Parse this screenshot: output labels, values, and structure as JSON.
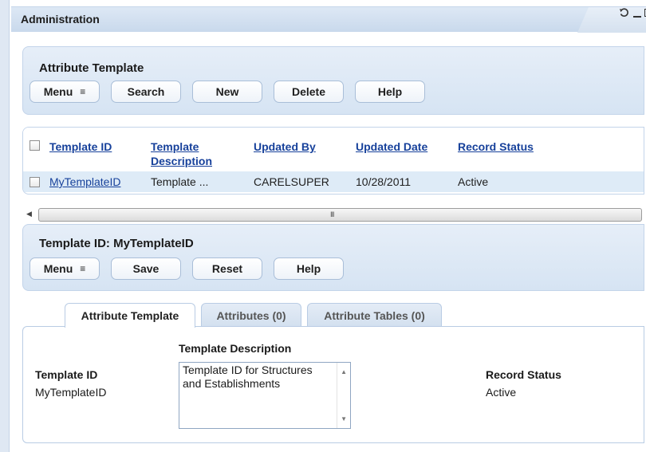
{
  "window": {
    "title": "Administration",
    "controls": {
      "refresh_icon": "refresh-icon",
      "minimize_icon": "minimize-icon",
      "maximize_icon": "maximize-icon"
    }
  },
  "search_panel": {
    "title": "Attribute Template",
    "buttons": {
      "menu": "Menu",
      "search": "Search",
      "new": "New",
      "delete": "Delete",
      "help": "Help"
    }
  },
  "grid": {
    "columns": [
      "Template ID",
      "Template Description",
      "Updated By",
      "Updated Date",
      "Record Status"
    ],
    "rows": [
      {
        "template_id": "MyTemplateID",
        "description": "Template ...",
        "updated_by": "CARELSUPER",
        "updated_date": "10/28/2011",
        "record_status": "Active"
      }
    ],
    "scroll_grip": "III"
  },
  "detail_panel": {
    "title": "Template ID: MyTemplateID",
    "buttons": {
      "menu": "Menu",
      "save": "Save",
      "reset": "Reset",
      "help": "Help"
    }
  },
  "tabs": [
    {
      "label": "Attribute Template",
      "active": true
    },
    {
      "label": "Attributes (0)",
      "active": false
    },
    {
      "label": "Attribute Tables (0)",
      "active": false
    }
  ],
  "form": {
    "template_id_label": "Template ID",
    "template_id_value": "MyTemplateID",
    "description_label": "Template Description",
    "description_value": "Template ID for Structures and Establishments",
    "record_status_label": "Record Status",
    "record_status_value": "Active"
  },
  "colors": {
    "link": "#17419b",
    "panel_bg": "#dae6f4",
    "row_selected": "#deebf7"
  }
}
